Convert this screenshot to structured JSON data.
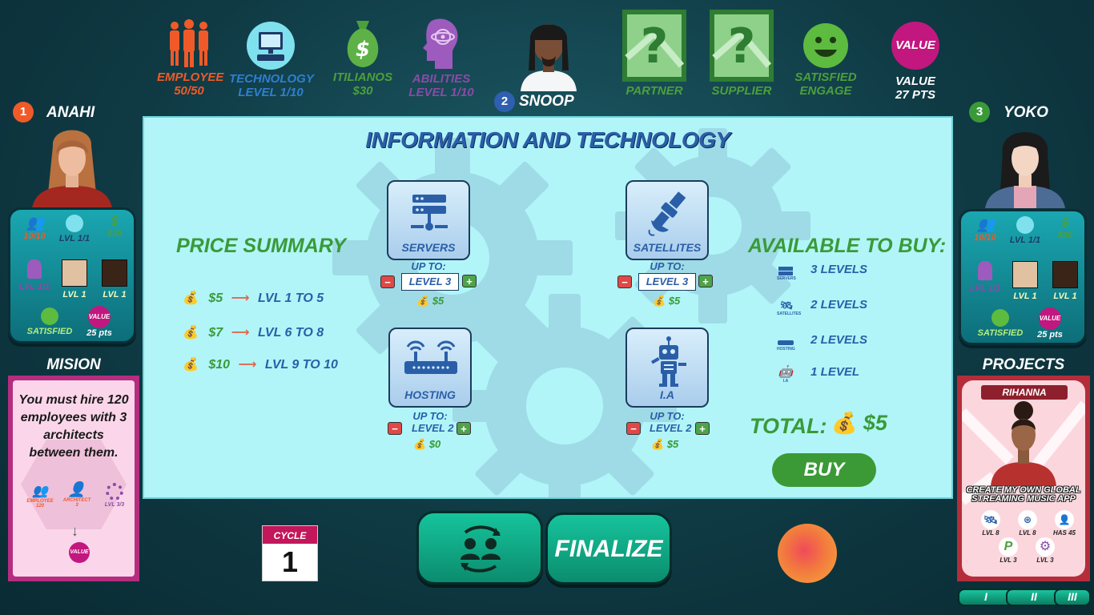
{
  "top_stats": {
    "employee": {
      "label": "EMPLOYEE",
      "value": "50/50",
      "color": "#f05a28"
    },
    "technology": {
      "label": "TECHNOLOGY",
      "value": "LEVEL  1/10",
      "color": "#2f7fd1"
    },
    "itilianos": {
      "label": "ITILIANOS",
      "value": "$30",
      "color": "#4d9f3b"
    },
    "abilities": {
      "label": "ABILITIES",
      "value": "LEVEL  1/10",
      "color": "#8a4ba8"
    },
    "current_player": {
      "number": "2",
      "name": "SNOOP"
    },
    "partner": {
      "label": "PARTNER",
      "icon": "question-card-icon"
    },
    "supplier": {
      "label": "SUPPLIER",
      "icon": "question-card-icon"
    },
    "satisfied": {
      "line1": "SATISFIED",
      "line2": "ENGAGE"
    },
    "value": {
      "badge": "VALUE",
      "line1": "VALUE",
      "line2": "27 PTS"
    }
  },
  "left_player": {
    "number": "1",
    "name": "ANAHI",
    "employees": "10/10",
    "tech": "LVL 1/1",
    "money": "$30",
    "abilities": "LVL 1/1",
    "partner": "LVL 1",
    "supplier": "LVL 1",
    "satisfied": "SATISFIED",
    "value_badge": "VALUE",
    "points": "25 pts"
  },
  "right_player": {
    "number": "3",
    "name": "YOKO",
    "employees": "10/10",
    "tech": "LVL 1/1",
    "money": "$30",
    "abilities": "LVL 1/1",
    "partner": "LVL 1",
    "supplier": "LVL 1",
    "satisfied": "SATISFIED",
    "value_badge": "VALUE",
    "points": "25 pts"
  },
  "panel": {
    "title": "INFORMATION AND TECHNOLOGY",
    "price_summary": {
      "heading": "PRICE SUMMARY",
      "rows": [
        {
          "price": "$5",
          "levels": "LVL 1 TO 5"
        },
        {
          "price": "$7",
          "levels": "LVL 6 TO 8"
        },
        {
          "price": "$10",
          "levels": "LVL 9 TO 10"
        }
      ]
    },
    "items": {
      "servers": {
        "label": "SERVERS",
        "upto": "UP TO:",
        "level": "LEVEL 3",
        "cost": "$5"
      },
      "satellites": {
        "label": "SATELLITES",
        "upto": "UP TO:",
        "level": "LEVEL 3",
        "cost": "$5"
      },
      "hosting": {
        "label": "HOSTING",
        "upto": "UP TO:",
        "level": "LEVEL 2",
        "cost": "$0"
      },
      "ia": {
        "label": "I.A",
        "upto": "UP TO:",
        "level": "LEVEL 2",
        "cost": "$5"
      }
    },
    "available": {
      "heading": "AVAILABLE TO BUY:",
      "rows": [
        {
          "icon": "servers-icon",
          "caption": "SERVERS",
          "text": "3 LEVELS"
        },
        {
          "icon": "satellites-icon",
          "caption": "SATELLITES",
          "text": "2 LEVELS"
        },
        {
          "icon": "hosting-icon",
          "caption": "HOSTING",
          "text": "2 LEVELS"
        },
        {
          "icon": "robot-icon",
          "caption": "I.A",
          "text": "1 LEVEL"
        }
      ]
    },
    "total_label": "TOTAL:",
    "total_value": "$5",
    "buy_label": "BUY"
  },
  "mission": {
    "title": "MISION",
    "text": "You must hire 120 employees with 3 architects between them.",
    "employee_caption": "EMPLOYEE",
    "employee_count": "120",
    "architect_caption": "ARCHITECT",
    "architect_count": "3",
    "level_caption": "LVL 3/3",
    "value_badge": "VALUE"
  },
  "projects": {
    "title": "PROJECTS",
    "card_name": "RIHANNA",
    "card_text": "CREATE MY OWN GLOBAL STREAMING MUSIC APP",
    "req1": "LVL 8",
    "req2": "LVL 8",
    "req3": "HAS 45",
    "req4": "LVL 3",
    "req5": "LVL 3",
    "pages": [
      "I",
      "II",
      "III"
    ]
  },
  "cycle": {
    "label": "CYCLE",
    "value": "1"
  },
  "finalize_label": "FINALIZE",
  "colors": {
    "panel_bg": "#b1f5f8",
    "title_blue": "#2a5fa8",
    "accent_green": "#3a9a38",
    "button_teal": "#16c49c",
    "value_magenta": "#c2177f"
  }
}
